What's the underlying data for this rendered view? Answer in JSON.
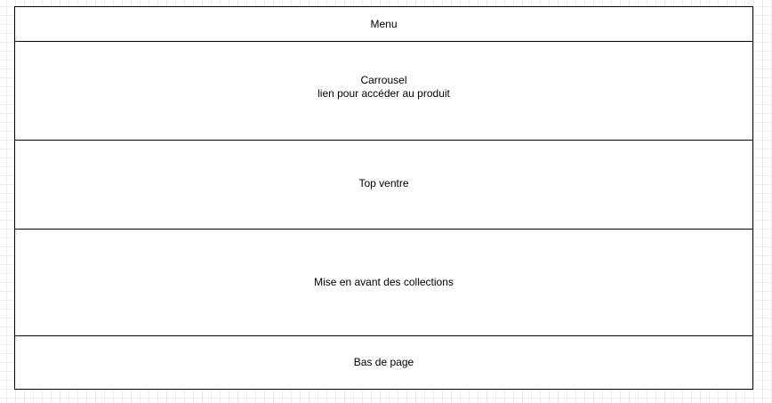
{
  "wireframe": {
    "menu": {
      "label": "Menu"
    },
    "carousel": {
      "title": "Carrousel",
      "subtitle": "lien pour accéder au produit"
    },
    "top_sales": {
      "label": "Top ventre"
    },
    "collections": {
      "label": "Mise en avant des collections"
    },
    "footer": {
      "label": "Bas de page"
    }
  },
  "colors": {
    "border": "#000000",
    "block_fill": "#ffffff",
    "grid": "#ececec"
  }
}
